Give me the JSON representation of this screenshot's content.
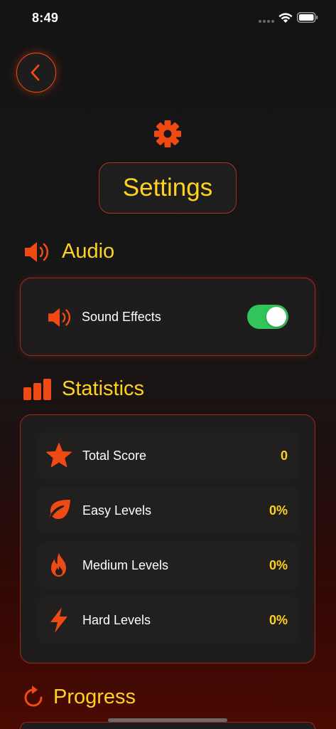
{
  "status_bar": {
    "time": "8:49"
  },
  "header": {
    "title": "Settings"
  },
  "sections": {
    "audio": {
      "heading": "Audio",
      "sound_effects": {
        "label": "Sound Effects",
        "enabled": true
      }
    },
    "statistics": {
      "heading": "Statistics",
      "rows": [
        {
          "label": "Total Score",
          "value": "0",
          "icon": "star-icon"
        },
        {
          "label": "Easy Levels",
          "value": "0%",
          "icon": "leaf-icon"
        },
        {
          "label": "Medium Levels",
          "value": "0%",
          "icon": "flame-icon"
        },
        {
          "label": "Hard Levels",
          "value": "0%",
          "icon": "bolt-icon"
        }
      ]
    },
    "progress": {
      "heading": "Progress"
    }
  },
  "colors": {
    "accent_orange": "#f04a14",
    "accent_yellow": "#ffd21f",
    "toggle_on": "#31c45a"
  }
}
